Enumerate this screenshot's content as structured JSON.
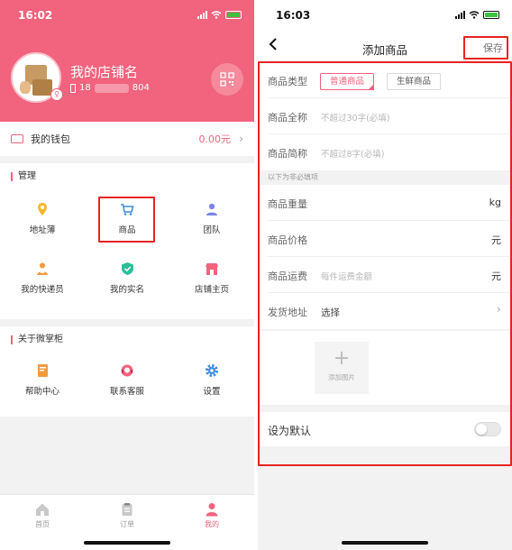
{
  "left": {
    "status": {
      "time": "16:02"
    },
    "profile": {
      "shop_name": "我的店铺名",
      "phone_prefix": "18",
      "phone_suffix": "804"
    },
    "wallet": {
      "label": "我的钱包",
      "value": "0.00元"
    },
    "manage": {
      "title": "管理",
      "items": [
        {
          "label": "地址薄",
          "icon": "location-pin-icon"
        },
        {
          "label": "商品",
          "icon": "cart-icon"
        },
        {
          "label": "团队",
          "icon": "team-icon"
        },
        {
          "label": "我的快递员",
          "icon": "courier-icon"
        },
        {
          "label": "我的实名",
          "icon": "verified-shield-icon"
        },
        {
          "label": "店铺主页",
          "icon": "storefront-icon"
        }
      ]
    },
    "about": {
      "title": "关于微掌柜",
      "items": [
        {
          "label": "帮助中心",
          "icon": "help-book-icon"
        },
        {
          "label": "联系客服",
          "icon": "customer-service-icon"
        },
        {
          "label": "设置",
          "icon": "gear-icon"
        }
      ]
    },
    "tabs": [
      {
        "label": "首页",
        "icon": "home-icon",
        "active": false
      },
      {
        "label": "订单",
        "icon": "orders-icon",
        "active": false
      },
      {
        "label": "我的",
        "icon": "profile-icon",
        "active": true
      }
    ]
  },
  "right": {
    "status": {
      "time": "16:03"
    },
    "nav": {
      "title": "添加商品",
      "save_label": "保存"
    },
    "type_row": {
      "label": "商品类型",
      "options": [
        "普通商品",
        "生鲜商品"
      ],
      "selected": "普通商品"
    },
    "fullname_row": {
      "label": "商品全称",
      "placeholder": "不超过30字(必填)"
    },
    "shortname_row": {
      "label": "商品简称",
      "placeholder": "不超过8字(必填)"
    },
    "optional_hint": "以下为非必填项",
    "weight_row": {
      "label": "商品重量",
      "unit": "kg"
    },
    "price_row": {
      "label": "商品价格",
      "unit": "元"
    },
    "shipping_row": {
      "label": "商品运费",
      "placeholder": "每件运费金额",
      "unit": "元"
    },
    "address_row": {
      "label": "发货地址",
      "value": "选择"
    },
    "photo": {
      "add_label": "添加图片"
    },
    "default_row": {
      "label": "设为默认",
      "toggle_on": false
    }
  },
  "colors": {
    "accent": "#f2637d",
    "highlight": "#e8231f"
  }
}
